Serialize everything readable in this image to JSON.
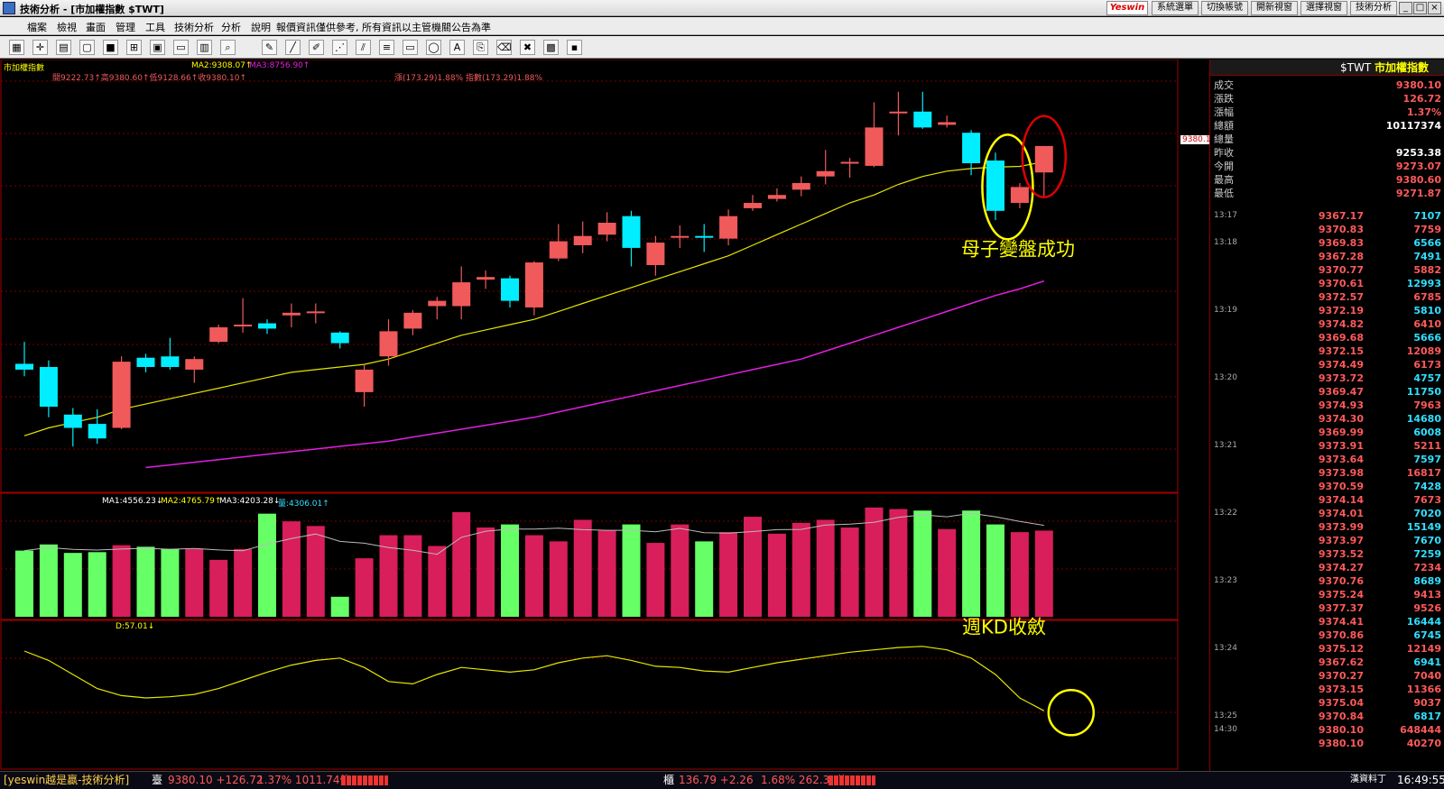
{
  "window": {
    "title": "技術分析 - [市加權指數 $TWT]",
    "logo": "Yeswin",
    "top_buttons": [
      "系統選單",
      "切換帳號",
      "開新視窗",
      "選擇視窗",
      "技術分析"
    ],
    "win_controls": [
      "_",
      "□",
      "×"
    ]
  },
  "menu": {
    "items": [
      "檔案",
      "檢視",
      "畫面",
      "管理",
      "工具",
      "技術分析",
      "分析",
      "說明"
    ],
    "notice": "報價資訊僅供參考, 所有資訊以主管機關公告為準"
  },
  "toolbar": {
    "icons": [
      "layout-icon",
      "crosshair-icon",
      "grid-icon",
      "select-icon",
      "color-icon",
      "period-icon",
      "chart-icon",
      "window-icon",
      "tile-icon",
      "zoom-icon",
      "draw-icon",
      "line-icon",
      "pencil-icon",
      "fib-icon",
      "parallel-icon",
      "channel-icon",
      "rect-icon",
      "ellipse-icon",
      "text-icon",
      "copy-icon",
      "eraser-icon",
      "trash-icon",
      "palette-icon",
      "save-icon"
    ]
  },
  "chart": {
    "price_header": {
      "symbol": "市加權指數",
      "ma2": "MA2:9308.07↑",
      "ma3": "MA3:8756.90↑",
      "ohlc": "開9222.73↑高9380.60↑低9128.66↑收9380.10↑",
      "change": "漲(173.29)1.88% 指數(173.29)1.88%"
    },
    "volume_header": {
      "ma1": "MA1:4556.23↓",
      "ma2": "MA2:4765.79↑",
      "ma3": "MA3:4203.28↓",
      "vol": "量:4306.01↑"
    },
    "kd_header": {
      "d": "D:57.01↓"
    },
    "price_tag": "9380.1",
    "annotations": {
      "pattern": "母子變盤成功",
      "kd": "週KD收斂"
    }
  },
  "chart_data": {
    "type": "candlestick",
    "title": "市加權指數 $TWT",
    "candles": [
      {
        "o": 8712,
        "h": 8795,
        "l": 8665,
        "c": 8690
      },
      {
        "o": 8700,
        "h": 8725,
        "l": 8510,
        "c": 8550
      },
      {
        "o": 8520,
        "h": 8545,
        "l": 8400,
        "c": 8470
      },
      {
        "o": 8485,
        "h": 8540,
        "l": 8410,
        "c": 8430
      },
      {
        "o": 8470,
        "h": 8740,
        "l": 8465,
        "c": 8720
      },
      {
        "o": 8735,
        "h": 8750,
        "l": 8680,
        "c": 8700
      },
      {
        "o": 8740,
        "h": 8810,
        "l": 8690,
        "c": 8700
      },
      {
        "o": 8690,
        "h": 8740,
        "l": 8640,
        "c": 8730
      },
      {
        "o": 8795,
        "h": 8860,
        "l": 8790,
        "c": 8850
      },
      {
        "o": 8860,
        "h": 8960,
        "l": 8830,
        "c": 8860
      },
      {
        "o": 8865,
        "h": 8880,
        "l": 8825,
        "c": 8845
      },
      {
        "o": 8895,
        "h": 8940,
        "l": 8850,
        "c": 8905
      },
      {
        "o": 8905,
        "h": 8940,
        "l": 8865,
        "c": 8910
      },
      {
        "o": 8830,
        "h": 8835,
        "l": 8770,
        "c": 8790
      },
      {
        "o": 8605,
        "h": 8710,
        "l": 8550,
        "c": 8690
      },
      {
        "o": 8740,
        "h": 8880,
        "l": 8705,
        "c": 8835
      },
      {
        "o": 8845,
        "h": 8915,
        "l": 8820,
        "c": 8905
      },
      {
        "o": 8930,
        "h": 8965,
        "l": 8880,
        "c": 8950
      },
      {
        "o": 8930,
        "h": 9080,
        "l": 8880,
        "c": 9020
      },
      {
        "o": 9030,
        "h": 9065,
        "l": 8995,
        "c": 9040
      },
      {
        "o": 9035,
        "h": 9045,
        "l": 8925,
        "c": 8950
      },
      {
        "o": 8925,
        "h": 9100,
        "l": 8895,
        "c": 9095
      },
      {
        "o": 9110,
        "h": 9240,
        "l": 9100,
        "c": 9175
      },
      {
        "o": 9160,
        "h": 9250,
        "l": 9130,
        "c": 9195
      },
      {
        "o": 9200,
        "h": 9285,
        "l": 9175,
        "c": 9245
      },
      {
        "o": 9270,
        "h": 9290,
        "l": 9080,
        "c": 9150
      },
      {
        "o": 9085,
        "h": 9195,
        "l": 9045,
        "c": 9170
      },
      {
        "o": 9195,
        "h": 9235,
        "l": 9150,
        "c": 9195
      },
      {
        "o": 9195,
        "h": 9240,
        "l": 9135,
        "c": 9190
      },
      {
        "o": 9185,
        "h": 9295,
        "l": 9160,
        "c": 9270
      },
      {
        "o": 9300,
        "h": 9350,
        "l": 9290,
        "c": 9320
      },
      {
        "o": 9335,
        "h": 9375,
        "l": 9325,
        "c": 9350
      },
      {
        "o": 9370,
        "h": 9420,
        "l": 9345,
        "c": 9395
      },
      {
        "o": 9420,
        "h": 9520,
        "l": 9390,
        "c": 9440
      },
      {
        "o": 9470,
        "h": 9490,
        "l": 9415,
        "c": 9475
      },
      {
        "o": 9460,
        "h": 9700,
        "l": 9455,
        "c": 9605
      },
      {
        "o": 9660,
        "h": 9740,
        "l": 9575,
        "c": 9665
      },
      {
        "o": 9665,
        "h": 9740,
        "l": 9600,
        "c": 9605
      },
      {
        "o": 9615,
        "h": 9650,
        "l": 9605,
        "c": 9625
      },
      {
        "o": 9585,
        "h": 9595,
        "l": 9425,
        "c": 9470
      },
      {
        "o": 9480,
        "h": 9510,
        "l": 9255,
        "c": 9290
      },
      {
        "o": 9320,
        "h": 9395,
        "l": 9300,
        "c": 9380
      },
      {
        "o": 9435,
        "h": 9455,
        "l": 9340,
        "c": 9535
      }
    ],
    "ma_yellow": [
      8440,
      8470,
      8490,
      8510,
      8540,
      8560,
      8580,
      8600,
      8620,
      8640,
      8660,
      8680,
      8690,
      8700,
      8710,
      8730,
      8760,
      8790,
      8820,
      8840,
      8860,
      8880,
      8910,
      8940,
      8970,
      9000,
      9030,
      9060,
      9090,
      9120,
      9160,
      9200,
      9240,
      9280,
      9320,
      9350,
      9390,
      9420,
      9440,
      9450,
      9455,
      9458,
      9475
    ],
    "ma_magenta": [
      8270,
      8280,
      8290,
      8300,
      8310,
      8320,
      8330,
      8340,
      8350,
      8360,
      8370,
      8380,
      8390,
      8400,
      8410,
      8420,
      8435,
      8450,
      8465,
      8480,
      8495,
      8510,
      8530,
      8550,
      8570,
      8590,
      8610,
      8630,
      8650,
      8670,
      8690,
      8710,
      8730,
      8760,
      8790,
      8820,
      8850,
      8880,
      8910,
      8940,
      8970,
      8995,
      9025
    ],
    "ylim": [
      8240,
      9780
    ],
    "volume": [
      4300,
      4700,
      4150,
      4200,
      4650,
      4550,
      4400,
      4400,
      3700,
      4400,
      6700,
      6200,
      5900,
      1300,
      3800,
      5300,
      5300,
      4600,
      6800,
      5800,
      6000,
      5300,
      4900,
      6300,
      5600,
      6000,
      4800,
      6000,
      4900,
      5500,
      6500,
      5400,
      6100,
      6300,
      5800,
      7100,
      7000,
      6900,
      5700,
      6900,
      6000,
      5500,
      5600
    ],
    "volume_ylim": [
      0,
      7500
    ],
    "kd": [
      80,
      72,
      60,
      48,
      42,
      40,
      41,
      43,
      48,
      55,
      62,
      68,
      72,
      74,
      66,
      54,
      52,
      60,
      66,
      64,
      62,
      64,
      70,
      74,
      76,
      72,
      67,
      66,
      63,
      62,
      66,
      70,
      73,
      76,
      79,
      81,
      83,
      84,
      81,
      74,
      60,
      40,
      29
    ],
    "kd_ylim": [
      0,
      100
    ]
  },
  "quote": {
    "title_code": "$TWT",
    "title_name": "市加權指數",
    "rows": [
      {
        "label": "成交",
        "value": "9380.10",
        "color": "#ff5a5a"
      },
      {
        "label": "漲跌",
        "value": "126.72",
        "color": "#ff5a5a"
      },
      {
        "label": "漲幅",
        "value": "1.37%",
        "color": "#ff5a5a"
      },
      {
        "label": "總額",
        "value": "10117374",
        "color": "#ffffff"
      },
      {
        "label": "總量",
        "value": "",
        "color": "#ffffff"
      },
      {
        "label": "昨收",
        "value": "9253.38",
        "color": "#ffffff"
      },
      {
        "label": "今開",
        "value": "9273.07",
        "color": "#ff5a5a"
      },
      {
        "label": "最高",
        "value": "9380.60",
        "color": "#ff5a5a"
      },
      {
        "label": "最低",
        "value": "9271.87",
        "color": "#ff5a5a"
      }
    ],
    "ticks": [
      {
        "time": "13:17",
        "price": "9367.17",
        "vol": "7107",
        "vc": "#30e0ff"
      },
      {
        "time": "",
        "price": "9370.83",
        "vol": "7759",
        "vc": "#ff5a5a"
      },
      {
        "time": "13:18",
        "price": "9369.83",
        "vol": "6566",
        "vc": "#30e0ff"
      },
      {
        "time": "",
        "price": "9367.28",
        "vol": "7491",
        "vc": "#30e0ff"
      },
      {
        "time": "",
        "price": "9370.77",
        "vol": "5882",
        "vc": "#ff5a5a"
      },
      {
        "time": "",
        "price": "9370.61",
        "vol": "12993",
        "vc": "#30e0ff"
      },
      {
        "time": "",
        "price": "9372.57",
        "vol": "6785",
        "vc": "#ff5a5a"
      },
      {
        "time": "13:19",
        "price": "9372.19",
        "vol": "5810",
        "vc": "#30e0ff"
      },
      {
        "time": "",
        "price": "9374.82",
        "vol": "6410",
        "vc": "#ff5a5a"
      },
      {
        "time": "",
        "price": "9369.68",
        "vol": "5666",
        "vc": "#30e0ff"
      },
      {
        "time": "",
        "price": "9372.15",
        "vol": "12089",
        "vc": "#ff5a5a"
      },
      {
        "time": "",
        "price": "9374.49",
        "vol": "6173",
        "vc": "#ff5a5a"
      },
      {
        "time": "13:20",
        "price": "9373.72",
        "vol": "4757",
        "vc": "#30e0ff"
      },
      {
        "time": "",
        "price": "9369.47",
        "vol": "11750",
        "vc": "#30e0ff"
      },
      {
        "time": "",
        "price": "9374.93",
        "vol": "7963",
        "vc": "#ff5a5a"
      },
      {
        "time": "",
        "price": "9374.30",
        "vol": "14680",
        "vc": "#30e0ff"
      },
      {
        "time": "",
        "price": "9369.99",
        "vol": "6008",
        "vc": "#30e0ff"
      },
      {
        "time": "13:21",
        "price": "9373.91",
        "vol": "5211",
        "vc": "#ff5a5a"
      },
      {
        "time": "",
        "price": "9373.64",
        "vol": "7597",
        "vc": "#30e0ff"
      },
      {
        "time": "",
        "price": "9373.98",
        "vol": "16817",
        "vc": "#ff5a5a"
      },
      {
        "time": "",
        "price": "9370.59",
        "vol": "7428",
        "vc": "#30e0ff"
      },
      {
        "time": "",
        "price": "9374.14",
        "vol": "7673",
        "vc": "#ff5a5a"
      },
      {
        "time": "13:22",
        "price": "9374.01",
        "vol": "7020",
        "vc": "#30e0ff"
      },
      {
        "time": "",
        "price": "9373.99",
        "vol": "15149",
        "vc": "#30e0ff"
      },
      {
        "time": "",
        "price": "9373.97",
        "vol": "7670",
        "vc": "#30e0ff"
      },
      {
        "time": "",
        "price": "9373.52",
        "vol": "7259",
        "vc": "#30e0ff"
      },
      {
        "time": "",
        "price": "9374.27",
        "vol": "7234",
        "vc": "#ff5a5a"
      },
      {
        "time": "13:23",
        "price": "9370.76",
        "vol": "8689",
        "vc": "#30e0ff"
      },
      {
        "time": "",
        "price": "9375.24",
        "vol": "9413",
        "vc": "#ff5a5a"
      },
      {
        "time": "",
        "price": "9377.37",
        "vol": "9526",
        "vc": "#ff5a5a"
      },
      {
        "time": "",
        "price": "9374.41",
        "vol": "16444",
        "vc": "#30e0ff"
      },
      {
        "time": "",
        "price": "9370.86",
        "vol": "6745",
        "vc": "#30e0ff"
      },
      {
        "time": "13:24",
        "price": "9375.12",
        "vol": "12149",
        "vc": "#ff5a5a"
      },
      {
        "time": "",
        "price": "9367.62",
        "vol": "6941",
        "vc": "#30e0ff"
      },
      {
        "time": "",
        "price": "9370.27",
        "vol": "7040",
        "vc": "#ff5a5a"
      },
      {
        "time": "",
        "price": "9373.15",
        "vol": "11366",
        "vc": "#ff5a5a"
      },
      {
        "time": "",
        "price": "9375.04",
        "vol": "9037",
        "vc": "#ff5a5a"
      },
      {
        "time": "13:25",
        "price": "9370.84",
        "vol": "6817",
        "vc": "#30e0ff"
      },
      {
        "time": "14:30",
        "price": "9380.10",
        "vol": "648444",
        "vc": "#ff5a5a"
      },
      {
        "time": "",
        "price": "9380.10",
        "vol": "40270",
        "vc": "#ff5a5a"
      }
    ]
  },
  "status": {
    "app": "[yeswin越是贏-技術分析]",
    "idx_label": "臺",
    "idx_value": "9380.10 +126.72",
    "idx_pct": "1.37% 1011.74億",
    "otc_label": "櫃",
    "otc_value": "136.79 +2.26",
    "otc_pct": "1.68% 262.31億",
    "ime": "漢資料丁",
    "time": "16:49:55"
  },
  "colors": {
    "up": "#f05a5a",
    "down": "#00eeff",
    "vol_up": "#d81e5b",
    "vol_down": "#66ff66",
    "ma_yellow": "#e6e600",
    "ma_magenta": "#e020e0"
  }
}
